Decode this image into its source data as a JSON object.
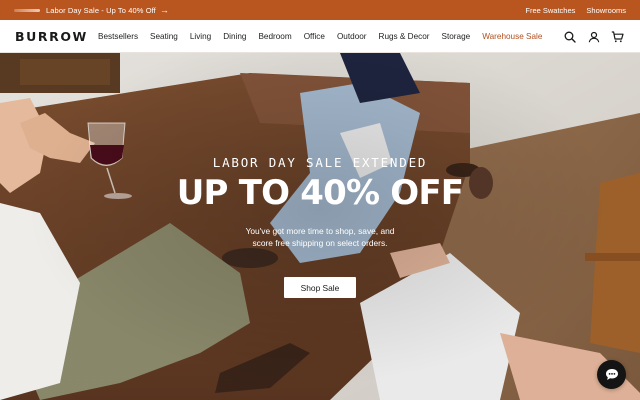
{
  "promo": {
    "text": "Labor Day Sale - Up To 40% Off",
    "arrow": "→",
    "links": [
      "Free Swatches",
      "Showrooms"
    ]
  },
  "brand": {
    "logo": "BURROW"
  },
  "nav": {
    "items": [
      "Bestsellers",
      "Seating",
      "Living",
      "Dining",
      "Bedroom",
      "Office",
      "Outdoor",
      "Rugs & Decor",
      "Storage",
      "Warehouse Sale"
    ],
    "icons": [
      "search-icon",
      "account-icon",
      "cart-icon"
    ]
  },
  "hero": {
    "eyebrow": "LABOR DAY SALE EXTENDED",
    "title": "UP TO 40% OFF",
    "subtitle_line1": "You've got more time to shop, save, and",
    "subtitle_line2": "score free shipping on select orders.",
    "cta": "Shop Sale"
  },
  "chat": {
    "icon": "chat-icon"
  },
  "colors": {
    "promo_bar": "#b9561f",
    "sale_link": "#b14f1f",
    "sofa": "#6b4328"
  }
}
